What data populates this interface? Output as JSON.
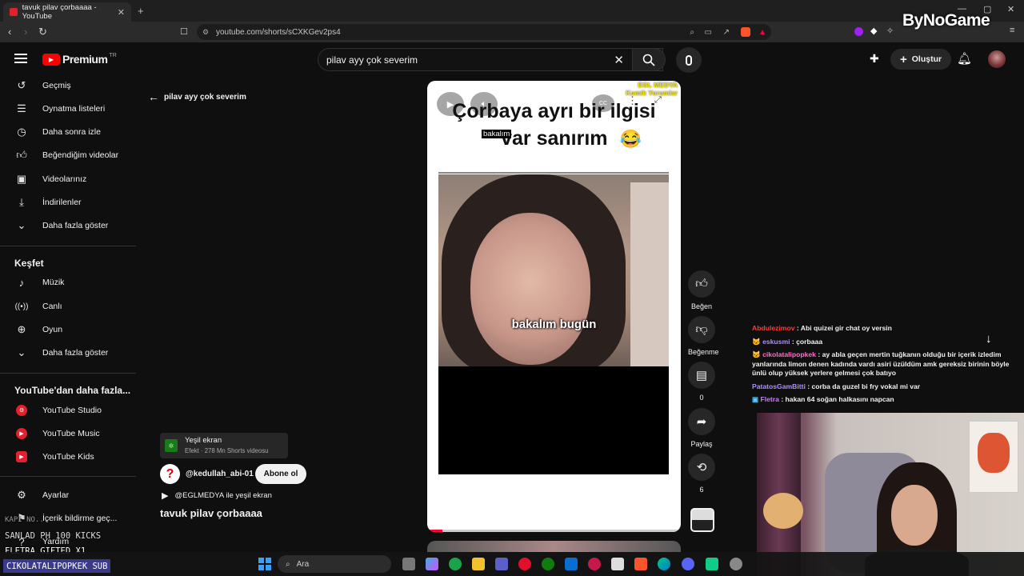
{
  "browser": {
    "tab_title": "tavuk pilav çorbaaaa - YouTube",
    "url": "youtube.com/shorts/sCXKGev2ps4",
    "watermark": "ByNoGame"
  },
  "header": {
    "logo": "Premium",
    "region": "TR",
    "search_value": "pilav ayy çok severim",
    "create_label": "Oluştur"
  },
  "sidebar": {
    "items": [
      {
        "label": "Geçmiş",
        "icon": "history-icon"
      },
      {
        "label": "Oynatma listeleri",
        "icon": "playlist-icon"
      },
      {
        "label": "Daha sonra izle",
        "icon": "clock-icon"
      },
      {
        "label": "Beğendiğim videolar",
        "icon": "thumbs-up-icon"
      },
      {
        "label": "Videolarınız",
        "icon": "video-icon"
      },
      {
        "label": "İndirilenler",
        "icon": "download-icon"
      },
      {
        "label": "Daha fazla göster",
        "icon": "chevron-down-icon"
      }
    ],
    "explore_title": "Keşfet",
    "explore": [
      {
        "label": "Müzik",
        "icon": "music-icon"
      },
      {
        "label": "Canlı",
        "icon": "live-icon"
      },
      {
        "label": "Oyun",
        "icon": "gamepad-icon"
      },
      {
        "label": "Daha fazla göster",
        "icon": "chevron-down-icon"
      }
    ],
    "more_title": "YouTube'dan daha fazla...",
    "more": [
      {
        "label": "YouTube Studio"
      },
      {
        "label": "YouTube Music"
      },
      {
        "label": "YouTube Kids"
      }
    ],
    "settings": "Ayarlar",
    "report": "İçerik bildirme geç...",
    "help": "Yardım"
  },
  "back_label": "pilav ayy çok severim",
  "video": {
    "channel_badge_1": "EGL MEDYA",
    "channel_badge_2": "Komik Yorumlar",
    "caption_line1": "Çorbaya ayrı bir ilgisi",
    "caption_line2": "var sanırım",
    "emoji": "😂",
    "subtitle_top": "bakalım",
    "subtitle_mid": "bakalım bugün",
    "cc": "CC"
  },
  "actions": {
    "like": "Beğen",
    "dislike": "Beğenme",
    "comments": "0",
    "share": "Paylaş",
    "remix": "6"
  },
  "meta": {
    "effect_title": "Yeşil ekran",
    "effect_sub": "Efekt · 278 Mn Shorts videosu",
    "channel": "@kedullah_abi-01",
    "subscribe": "Abone ol",
    "sound": "@EGLMEDYA ile yeşil ekran",
    "title": "tavuk pilav çorbaaaa"
  },
  "chat": [
    {
      "user": "Abdulezimov",
      "color": "#ff3b3b",
      "msg": ": Abi quizei gir chat oy versin"
    },
    {
      "user": "eskusmi",
      "color": "#b38cff",
      "msg": ": çorbaaa"
    },
    {
      "user": "cikolatalipopkek",
      "color": "#ff6ec7",
      "msg": ": ay abla geçen mertin tuğkanın olduğu bir içerik izledim yanlarında limon denen kadında vardı asiri üzüldüm amk gereksiz birinin böyle ünlü olup yüksek yerlere gelmesi çok batıyo"
    },
    {
      "user": "PatatosGamBitti",
      "color": "#b38cff",
      "msg": ": corba da guzel bi fry vokal mi var"
    },
    {
      "user": "Fletra",
      "color": "#c77dff",
      "msg": ": hakan 64 soğan halkasını napcan"
    }
  ],
  "stream_overlay": {
    "line0": "KAPI'NO...",
    "line1": "SANLAD  PH  100 KICKS",
    "line2": "FLETRA  GIFTED X1",
    "line3": "CIKOLATALIPOPKEK  SUB"
  },
  "taskbar": {
    "search": "Ara"
  }
}
